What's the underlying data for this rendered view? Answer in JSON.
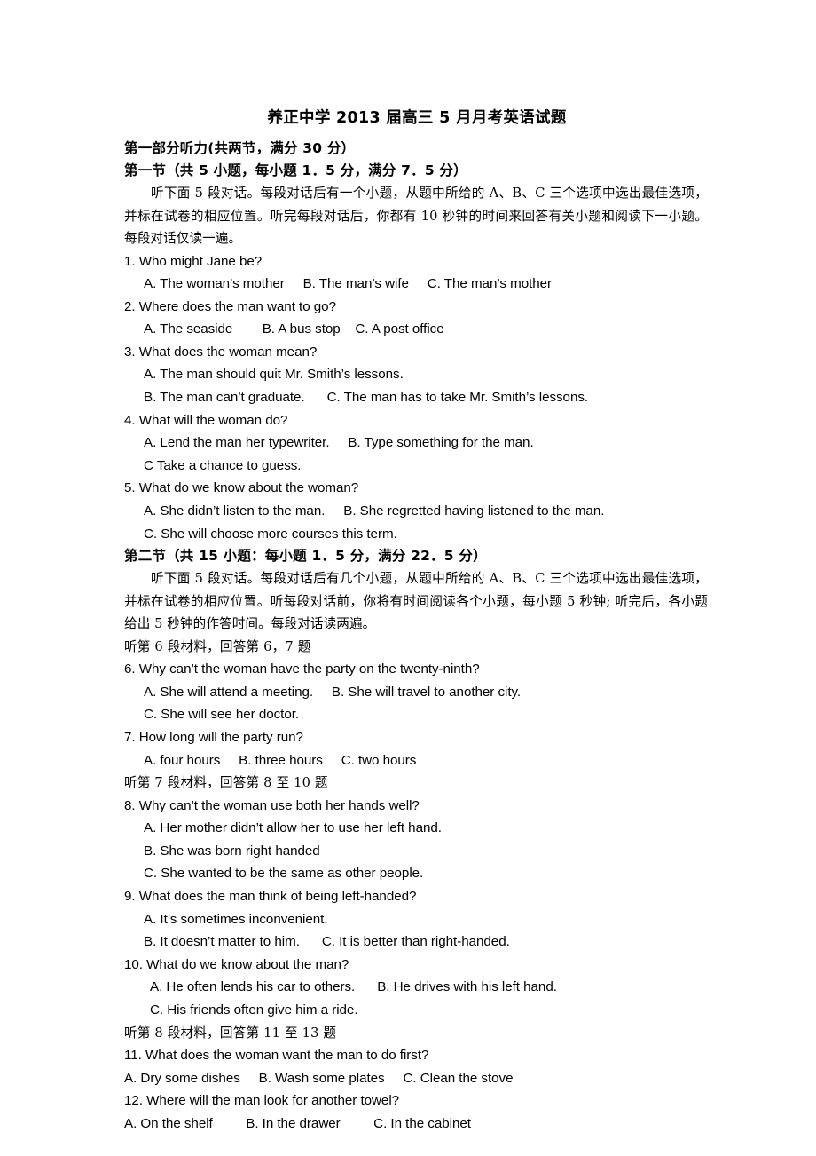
{
  "document": {
    "title": "养正中学 2013 届高三 5 月月考英语试题",
    "part_one_heading": "第一部分听力(共两节，满分 30 分）",
    "section_one": {
      "heading": "第一节（共 5 小题，每小题 1．5 分，满分 7．5 分）",
      "instruction": "听下面 5 段对话。每段对话后有一个小题，从题中所给的 A、B、C 三个选项中选出最佳选项，并标在试卷的相应位置。听完每段对话后，你都有 10 秒钟的时间来回答有关小题和阅读下一小题。每段对话仅读一遍。"
    },
    "section_two": {
      "heading": "第二节（共 15 小题：每小题 1．5 分，满分 22．5 分）",
      "instruction": "听下面 5 段对话。每段对话后有几个小题，从题中所给的 A、B、C 三个选项中选出最佳选项，并标在试卷的相应位置。听每段对话前，你将有时间阅读各个小题，每小题 5 秒钟; 听完后，各小题给出 5 秒钟的作答时间。每段对话读两遍。"
    },
    "material_cues": {
      "cue_6_7": "听第 6 段材料，回答第 6，7 题",
      "cue_8_10": "听第 7 段材料，回答第 8 至 10 题",
      "cue_11_13": "听第 8 段材料，回答第 11 至 13 题"
    },
    "questions": [
      {
        "number": "1",
        "stem": "1. Who might Jane be?",
        "indent": "opt-indent-1",
        "option_lines": [
          "A. The woman’s mother     B. The man’s wife     C. The man’s mother"
        ]
      },
      {
        "number": "2",
        "stem": "2. Where does the man want to go?",
        "indent": "opt-indent-1",
        "option_lines": [
          "A. The seaside        B. A bus stop    C. A post office"
        ]
      },
      {
        "number": "3",
        "stem": "3. What does the woman mean?",
        "indent": "opt-indent-1",
        "option_lines": [
          "A. The man should quit Mr. Smith’s lessons.",
          "B. The man can’t graduate.      C. The man has to take Mr. Smith’s lessons."
        ]
      },
      {
        "number": "4",
        "stem": "4. What will the woman do?",
        "indent": "opt-indent-1",
        "option_lines": [
          "A. Lend the man her typewriter.     B. Type something for the man.",
          "C Take a chance to guess."
        ]
      },
      {
        "number": "5",
        "stem": "5. What do we know about the woman?",
        "indent": "opt-indent-1",
        "option_lines": [
          "A. She didn’t listen to the man.     B. She regretted having listened to the man.",
          "C. She will choose more courses this term."
        ]
      },
      {
        "number": "6",
        "stem": "6. Why can’t the woman have the party on the twenty-ninth?",
        "indent": "opt-indent-1",
        "option_lines": [
          "A. She will attend a meeting.     B. She will travel to another city.",
          "C. She will see her doctor."
        ]
      },
      {
        "number": "7",
        "stem": "7. How long will the party run?",
        "indent": "opt-indent-1",
        "option_lines": [
          "A. four hours     B. three hours     C. two hours"
        ]
      },
      {
        "number": "8",
        "stem": "8. Why can’t the woman use both her hands well?",
        "indent": "opt-indent-1",
        "option_lines": [
          "A. Her mother didn’t allow her to use her left hand.",
          "B. She was born right handed",
          "C. She wanted to be the same as other people."
        ]
      },
      {
        "number": "9",
        "stem": "9. What does the man think of being left-handed?",
        "indent": "opt-indent-1",
        "option_lines": [
          "A. It’s sometimes inconvenient.",
          "B. It doesn’t matter to him.      C. It is better than right-handed."
        ]
      },
      {
        "number": "10",
        "stem": "10. What do we know about the man?",
        "indent": "opt-indent-2",
        "option_lines": [
          "A. He often lends his car to others.      B. He drives with his left hand.",
          "C. His friends often give him a ride."
        ]
      },
      {
        "number": "11",
        "stem": "11. What does the woman want the man to do first?",
        "indent": "opt-indent-0",
        "option_lines": [
          "A. Dry some dishes     B. Wash some plates     C. Clean the stove"
        ]
      },
      {
        "number": "12",
        "stem": "12. Where will the man look for another towel?",
        "indent": "opt-indent-0",
        "option_lines": [
          "A. On the shelf         B. In the drawer         C. In the cabinet"
        ]
      }
    ]
  }
}
